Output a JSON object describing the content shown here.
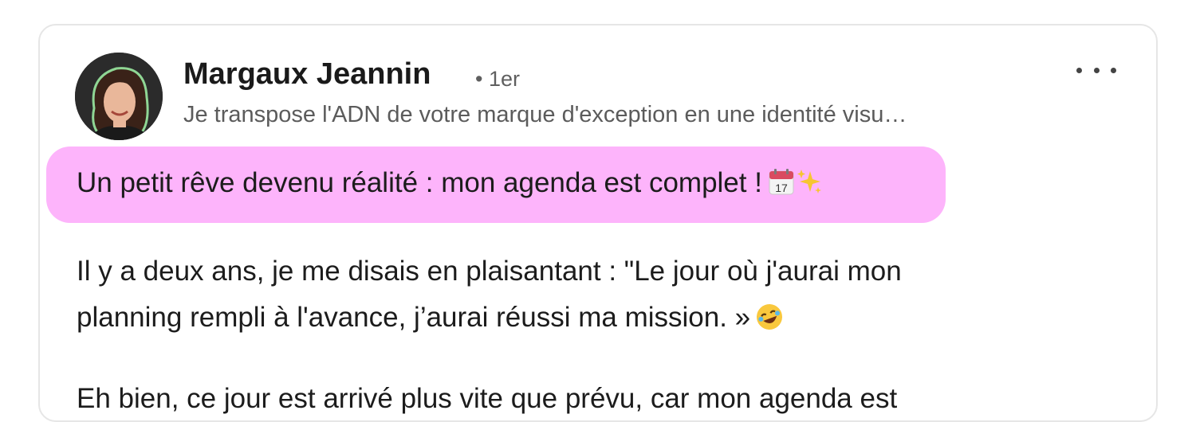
{
  "post": {
    "author": {
      "name": "Margaux Jeannin",
      "degree": "• 1er",
      "headline": "Je transpose l'ADN de votre marque d'exception en une identité visu…"
    },
    "menu_icon": "more-horizontal-icon",
    "highlight_line": "Un petit rêve devenu réalité : mon agenda est complet !",
    "highlight_emojis": [
      "calendar-icon",
      "sparkles-icon"
    ],
    "calendar_emoji_day": "17",
    "paragraph1_line1": "Il y a deux ans, je me disais en plaisantant : \"Le jour où j'aurai mon",
    "paragraph1_line2": "planning rempli à l'avance, j’aurai réussi ma mission. »",
    "paragraph1_emoji": "rolling-laughing-icon",
    "paragraph2_line1": "Eh bien, ce jour est arrivé plus vite que prévu, car mon agenda est"
  },
  "colors": {
    "highlight": "#fdb4fb",
    "card_border": "#e6e6e6",
    "avatar_ring": "#8fd694"
  }
}
